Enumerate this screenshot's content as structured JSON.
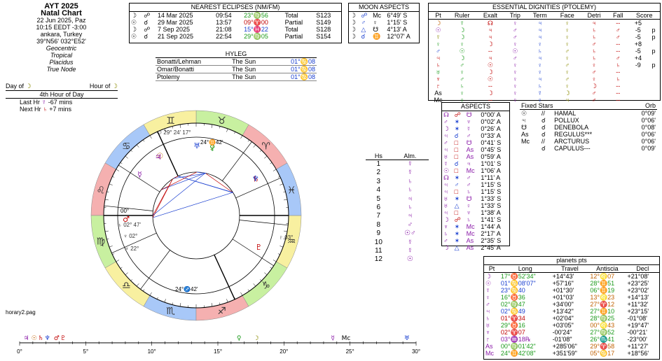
{
  "header": {
    "title": "AYT 2025",
    "subtitle": "Natal Chart",
    "date": "22 Jun 2025, Paz",
    "time": "10:15  EEDT -3:00",
    "place": "ankara, Turkey",
    "coords": "39°N56' 032°E52'",
    "zodiac": "Geocentric",
    "mode": "Tropical",
    "houses": "Placidus",
    "node": "True Node"
  },
  "day_hour": {
    "day_label": "Day of",
    "day_glyph": "☽",
    "hour_label": "Hour of",
    "hour_glyph": "☽",
    "hour_text": "4th Hour of Day",
    "last_label": "Last Hr",
    "last_glyph": "☿",
    "last_val": "-67 mins",
    "next_label": "Next Hr",
    "next_glyph": "♄",
    "next_val": "+7 mins"
  },
  "eclipses": {
    "caption": "NEAREST ECLIPSES (NM/FM)",
    "rows": [
      {
        "g1": "☽",
        "g2": "☍",
        "date": "14 Mar 2025",
        "time": "09:54",
        "pos": "23°♍56",
        "kind": "Total",
        "saros": "S123"
      },
      {
        "g1": "☉",
        "g2": "☌",
        "date": "29 Mar 2025",
        "time": "13:57",
        "pos": "09°♈00",
        "kind": "Partial",
        "saros": "S149"
      },
      {
        "g1": "☽",
        "g2": "☍",
        "date": "7 Sep 2025",
        "time": "21:08",
        "pos": "15°♓22",
        "kind": "Total",
        "saros": "S128"
      },
      {
        "g1": "☉",
        "g2": "☌",
        "date": "21 Sep 2025",
        "time": "22:54",
        "pos": "29°♍05",
        "kind": "Partial",
        "saros": "S154"
      }
    ]
  },
  "moon_aspects": {
    "caption": "MOON ASPECTS",
    "rows": [
      {
        "a": "☽",
        "b": "☍",
        "c": "Mc",
        "val": "6°49' S"
      },
      {
        "a": "☽",
        "b": "♂",
        "c": "♀",
        "val": "1°15' S"
      },
      {
        "a": "☽",
        "b": "△",
        "c": "☋",
        "val": "4°13' A"
      },
      {
        "a": "☽",
        "b": "☌",
        "c": "♊",
        "val": "12°07' A"
      }
    ]
  },
  "hyleg": {
    "caption": "HYLEG",
    "rows": [
      {
        "name": "Bonatti/Lehman",
        "body": "The Sun",
        "pos": "01°♋08"
      },
      {
        "name": "Omar/Bonatti",
        "body": "The Sun",
        "pos": "01°♋08"
      },
      {
        "name": "Ptolemy",
        "body": "The Sun",
        "pos": "01°♋08"
      }
    ]
  },
  "dignities": {
    "caption": "ESSENTIAL DIGNITIES (PTOLEMY)",
    "headers": [
      "Pt",
      "Ruler",
      "Exalt",
      "Trip",
      "Term",
      "Face",
      "Detri",
      "Fall",
      "Score"
    ],
    "rows": [
      [
        "☽",
        "☿",
        "☊",
        "♀",
        "♃",
        "♀",
        "♃",
        "--",
        "+5",
        ""
      ],
      [
        "☉",
        "☽",
        "♃",
        "♂",
        "♃",
        "♀",
        "♄",
        "♂",
        "-5",
        "p"
      ],
      [
        "☿",
        "☽",
        "♃",
        "♂",
        "♃",
        "♀",
        "♄",
        "♂",
        "-5",
        "p"
      ],
      [
        "♀",
        "♀",
        "☽",
        "♀",
        "♀",
        "♀",
        "♂",
        "--",
        "+8",
        ""
      ],
      [
        "♂",
        "☉",
        "--",
        "☉",
        "♄",
        "♂",
        "♄",
        "--",
        "-5",
        "p"
      ],
      [
        "♃",
        "☽",
        "♃",
        "♂",
        "♃",
        "♀",
        "♄",
        "♂",
        "+4",
        ""
      ],
      [
        "♄",
        "♂",
        "☉",
        "♀",
        "♀",
        "♂",
        "♀",
        "♄",
        "-9",
        "p"
      ],
      [
        "♅",
        "♀",
        "☽",
        "♀",
        "♀",
        "♀",
        "♂",
        "--",
        "",
        ""
      ],
      [
        "♆",
        "♂",
        "☉",
        "♀",
        "♃",
        "♂",
        "♀",
        "♄",
        "",
        ""
      ],
      [
        "♇",
        "♄",
        "--",
        "♀",
        "♄",
        "♀",
        "☽",
        "--",
        "",
        ""
      ],
      [
        "As",
        "♀",
        "☽",
        "♀",
        "☿",
        "☽",
        "♂",
        "--",
        "",
        ""
      ],
      [
        "Mc",
        "♀",
        "--",
        "♀",
        "♀",
        "♃",
        "♂",
        "--",
        "",
        ""
      ]
    ]
  },
  "aspects": {
    "caption": "ASPECTS",
    "rows": [
      {
        "a": "☊",
        "b": "☍",
        "c": "☋",
        "val": "0°00' A"
      },
      {
        "a": "♂",
        "b": "✶",
        "c": "♆",
        "val": "0°02' A"
      },
      {
        "a": "☽",
        "b": "✶",
        "c": "☿",
        "val": "0°26' A"
      },
      {
        "a": "♃",
        "b": "☌",
        "c": "♂",
        "val": "0°33' A"
      },
      {
        "a": "♂",
        "b": "□",
        "c": "☋",
        "val": "0°41' S"
      },
      {
        "a": "♃",
        "b": "□",
        "c": "As",
        "val": "0°45' S"
      },
      {
        "a": "♅",
        "b": "□",
        "c": "As",
        "val": "0°59' A"
      },
      {
        "a": "☿",
        "b": "☌",
        "c": "♃",
        "val": "1°01' S"
      },
      {
        "a": "☉",
        "b": "□",
        "c": "Mc",
        "val": "1°06' A"
      },
      {
        "a": "☊",
        "b": "✶",
        "c": "♂",
        "val": "1°11' A"
      },
      {
        "a": "♃",
        "b": "♂",
        "c": "♂",
        "val": "1°15' S"
      },
      {
        "a": "♃",
        "b": "□",
        "c": "♄",
        "val": "1°15' S"
      },
      {
        "a": "♅",
        "b": "✶",
        "c": "☋",
        "val": "1°33' S"
      },
      {
        "a": "♅",
        "b": "△",
        "c": "♀",
        "val": "1°33' S"
      },
      {
        "a": "♃",
        "b": "□",
        "c": "♆",
        "val": "1°38' A"
      },
      {
        "a": "☽",
        "b": "☍",
        "c": "♄",
        "val": "1°41' S"
      },
      {
        "a": "♆",
        "b": "✶",
        "c": "Mc",
        "val": "1°44' A"
      },
      {
        "a": "♄",
        "b": "✶",
        "c": "Mc",
        "val": "2°17' A"
      },
      {
        "a": "♂",
        "b": "✶",
        "c": "As",
        "val": "2°35' S"
      },
      {
        "a": "☽",
        "b": "△",
        "c": "As",
        "val": "2°45' A"
      }
    ]
  },
  "fixed_stars": {
    "caption": "Fixed Stars",
    "orb_label": "Orb",
    "rows": [
      {
        "a": "☉",
        "b": "//",
        "name": "HAMAL",
        "orb": "0°09'"
      },
      {
        "a": "♃",
        "b": "☌",
        "name": "POLLUX",
        "orb": "0°06'"
      },
      {
        "a": "☋",
        "b": "☌",
        "name": "DENEBOLA",
        "orb": "0°08'"
      },
      {
        "a": "As",
        "b": "☌",
        "name": "REGULUS***",
        "orb": "0°06'"
      },
      {
        "a": "Mc",
        "b": "//",
        "name": "ARCTURUS",
        "orb": "0°06'"
      },
      {
        "a": "",
        "b": "☌",
        "name": "CAPULUS---",
        "orb": "0°09'"
      }
    ]
  },
  "houses": {
    "col1": "Hs",
    "col2": "Alm.",
    "rows": [
      {
        "h": "1",
        "g": "☿"
      },
      {
        "h": "2",
        "g": "☿"
      },
      {
        "h": "3",
        "g": "♄"
      },
      {
        "h": "4",
        "g": "♄"
      },
      {
        "h": "5",
        "g": "♃"
      },
      {
        "h": "6",
        "g": "♄"
      },
      {
        "h": "7",
        "g": "♃"
      },
      {
        "h": "8",
        "g": "♂"
      },
      {
        "h": "9",
        "g": "☉♂"
      },
      {
        "h": "10",
        "g": "☿"
      },
      {
        "h": "11",
        "g": "☿"
      },
      {
        "h": "12",
        "g": "☉"
      }
    ]
  },
  "planets": {
    "caption": "planets pts",
    "headers": [
      "Pt",
      "Long",
      "Travel",
      "Antiscia",
      "Decl"
    ],
    "rows": [
      {
        "pt": "☽",
        "long": "17°♉52'34\"",
        "travel": "+14°43'",
        "ant": "12°♌07",
        "decl": "+21°08'",
        "c": "green"
      },
      {
        "pt": "☉",
        "long": "01°♋08'07\"",
        "travel": "+57'16\"",
        "ant": "28°♊51",
        "decl": "+23°25'",
        "c": "blue"
      },
      {
        "pt": "☿",
        "long": "23°♋40",
        "travel": "+01°30'",
        "ant": "06°♊19",
        "decl": "+23°02'",
        "c": "blue"
      },
      {
        "pt": "♀",
        "long": "16°♉36",
        "travel": "+01°03'",
        "ant": "13°♌23",
        "decl": "+14°13'",
        "c": "green"
      },
      {
        "pt": "♂",
        "long": "02°♍47",
        "travel": "+34'00\"",
        "ant": "27°♈12",
        "decl": "+11°32'",
        "c": "green"
      },
      {
        "pt": "♃",
        "long": "02°♋49",
        "travel": "+13'42\"",
        "ant": "27°♊10",
        "decl": "+23°15'",
        "c": "blue"
      },
      {
        "pt": "♄",
        "long": "01°♈34",
        "travel": "+02'04\"",
        "ant": "28°♍25",
        "decl": "-01°08'",
        "c": "red"
      },
      {
        "pt": "♅",
        "long": "29°♉16",
        "travel": "+03'05\"",
        "ant": "00°♌43",
        "decl": "+19°47'",
        "c": "green"
      },
      {
        "pt": "♆",
        "long": "02°♈07",
        "travel": "-00'24\"",
        "ant": "27°♍52",
        "decl": "-00°21'",
        "c": "red"
      },
      {
        "pt": "♇",
        "long": "03°♒18℞",
        "travel": "-01'08\"",
        "ant": "26°♏41",
        "decl": "-23°00'",
        "c": "purple"
      },
      {
        "pt": "As",
        "long": "00°♍01'42\"",
        "travel": "+285'06\"",
        "ant": "29°♈58",
        "decl": "+11°27'",
        "c": "green"
      },
      {
        "pt": "Mc",
        "long": "24°♊42'08\"",
        "travel": "+351'59\"",
        "ant": "05°♋17",
        "decl": "+18°56'",
        "c": "green"
      }
    ]
  },
  "wheel": {
    "footnote": "horary2.pag",
    "asc_label": "00°",
    "mc_label": "24°♊42'",
    "ic_label": "24°♐42'",
    "planet_labels": [
      {
        "g": "☽",
        "t": "29° 24' 17°"
      },
      {
        "g": "♄",
        "t": "02° 47'"
      },
      {
        "g": "♇",
        "t": "03°"
      },
      {
        "g": "♆",
        "t": "02°"
      },
      {
        "g": "♆",
        "t": "22°"
      }
    ]
  },
  "timeline": {
    "ticks": [
      "0°",
      "5°",
      "10°",
      "15°",
      "20°",
      "25°",
      "30°"
    ]
  },
  "colors": {
    "fire": "#f5b0b0",
    "earth": "#c8f0a0",
    "air": "#f8f0a0",
    "water": "#a8c8f8",
    "accent": "#1a3fd0"
  }
}
